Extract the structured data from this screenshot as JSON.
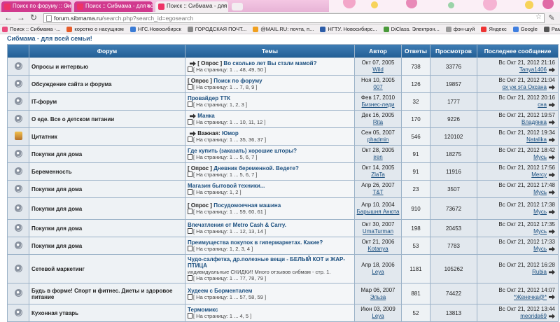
{
  "browser": {
    "tabs": [
      {
        "label": "Поиск по форуму :: Сиб"
      },
      {
        "label": "Поиск :: Сибмама - для вс"
      },
      {
        "label": "Поиск :: Сибмама - для в"
      }
    ],
    "url_host": "forum.sibmama.ru",
    "url_path": "/search.php?search_id=egosearch",
    "bookmarks": [
      {
        "label": "Поиск :: Сибмама -...",
        "color": "#e94b7d"
      },
      {
        "label": "коротко о насущном",
        "color": "#e65c2a"
      },
      {
        "label": "НГС.Новосибирск",
        "color": "#3a7bd5"
      },
      {
        "label": "ГОРОДСКАЯ ПОЧТ...",
        "color": "#888888"
      },
      {
        "label": "@MAIL.RU: почта, п...",
        "color": "#f0a020"
      },
      {
        "label": "НГТУ. Новосибирс...",
        "color": "#2d5da8"
      },
      {
        "label": "DiClass. Электрон...",
        "color": "#4a9a3a"
      },
      {
        "label": "фэн-шуй",
        "color": "#9a9a9a"
      },
      {
        "label": "Яндекс",
        "color": "#e33"
      },
      {
        "label": "Google",
        "color": "#3f7fe0"
      },
      {
        "label": "Рамблер",
        "color": "#555"
      }
    ]
  },
  "site_title": "Сибмама - для всей семьи!",
  "table": {
    "headers": {
      "forum": "Форум",
      "topics": "Темы",
      "author": "Автор",
      "replies": "Ответы",
      "views": "Просмотров",
      "last": "Последнее сообщение"
    },
    "rows": [
      {
        "forum": "Опросы и интервью",
        "prefix": "[ Опрос ]",
        "title": "Во сколько лет Вы стали мамой?",
        "pages": "[ На страницу: 1 ... 48, 49, 50 ]",
        "date": "Окт 07, 2005",
        "author": "Wild",
        "replies": "738",
        "views": "33776",
        "last_date": "Вс Окт 21, 2012 21:16",
        "last_user": "Tanya1406"
      },
      {
        "forum": "Обсуждение сайта и форума",
        "prefix": "[ Опрос ]",
        "title": "Поиск по форуму",
        "pages": "[ На страницу: 1 ... 7, 8, 9 ]",
        "date": "Ноя 10, 2005",
        "author": "007",
        "replies": "126",
        "views": "19857",
        "last_date": "Вс Окт 21, 2012 21:04",
        "last_user": "ох уж эта Оксана"
      },
      {
        "forum": "IT-форум",
        "prefix": "",
        "title": "Провайдер ТТК",
        "pages": "[ На страницу: 1, 2, 3 ]",
        "date": "Фев 17, 2010",
        "author": "Бизнес-леди",
        "replies": "32",
        "views": "1777",
        "last_date": "Вс Окт 21, 2012 20:16",
        "last_user": "сна"
      },
      {
        "forum": "О еде. Все о детском питании",
        "prefix": "",
        "title": "Манка",
        "pages": "[ На страницу: 1 ... 10, 11, 12 ]",
        "date": "Дек 16, 2005",
        "author": "Rita",
        "replies": "170",
        "views": "9226",
        "last_date": "Вс Окт 21, 2012 19:57",
        "last_user": "Владянка"
      },
      {
        "forum": "Цитатник",
        "prefix": "Важная:",
        "title": "Юмор",
        "pages": "[ На страницу: 1 ... 35, 36, 37 ]",
        "date": "Сен 05, 2007",
        "author": "phadmin",
        "replies": "546",
        "views": "120102",
        "last_date": "Вс Окт 21, 2012 19:34",
        "last_user": "Natalika"
      },
      {
        "forum": "Покупки для дома",
        "prefix": "",
        "title": "Где купить (заказать) хорошие шторы?",
        "pages": "[ На страницу: 1 ... 5, 6, 7 ]",
        "date": "Окт 28, 2005",
        "author": "iren",
        "replies": "91",
        "views": "18275",
        "last_date": "Вс Окт 21, 2012 18:42",
        "last_user": "Мусь"
      },
      {
        "forum": "Беременность",
        "prefix": "[ Опрос ]",
        "title": "Дневник беременной. Ведете?",
        "pages": "[ На страницу: 1 ... 5, 6, 7 ]",
        "date": "Окт 14, 2005",
        "author": "ZlaTa",
        "replies": "91",
        "views": "11916",
        "last_date": "Вс Окт 21, 2012 17:56",
        "last_user": "Mercy"
      },
      {
        "forum": "Покупки для дома",
        "prefix": "",
        "title": "Магазин бытовой техники...",
        "pages": "[ На страницу: 1, 2 ]",
        "date": "Апр 26, 2007",
        "author": "T&T",
        "replies": "23",
        "views": "3507",
        "last_date": "Вс Окт 21, 2012 17:48",
        "last_user": "Мусь"
      },
      {
        "forum": "Покупки для дома",
        "prefix": "[ Опрос ]",
        "title": "Посудомоечная машина",
        "pages": "[ На страницу: 1 ... 59, 60, 61 ]",
        "date": "Апр 10, 2004",
        "author": "Барышня Анюта",
        "replies": "910",
        "views": "73672",
        "last_date": "Вс Окт 21, 2012 17:38",
        "last_user": "Мусь"
      },
      {
        "forum": "Покупки для дома",
        "prefix": "",
        "title": "Впечатления от Metro Cash & Carry.",
        "pages": "[ На страницу: 1 ... 12, 13, 14 ]",
        "date": "Окт 30, 2007",
        "author": "UmaTurman",
        "replies": "198",
        "views": "20453",
        "last_date": "Вс Окт 21, 2012 17:35",
        "last_user": "Мусь"
      },
      {
        "forum": "Покупки для дома",
        "prefix": "",
        "title": "Преимущества покупок в гипермаркетах. Какие?",
        "pages": "[ На страницу: 1, 2, 3, 4 ]",
        "date": "Окт 21, 2006",
        "author": "Kotanya",
        "replies": "53",
        "views": "7783",
        "last_date": "Вс Окт 21, 2012 17:33",
        "last_user": "Мусь"
      },
      {
        "forum": "Сетевой маркетинг",
        "prefix": "",
        "title": "Чудо-салфетка, др.полезные вещи - БЕЛЫЙ КОТ и ЖАР-ПТИЦА",
        "subtitle": "индивидуальные СКИДКИ! Много отзывов сибмам - стр. 1.",
        "pages": "[ На страницу: 1 ... 77, 78, 79 ]",
        "date": "Апр 18, 2006",
        "author": "Leya",
        "replies": "1181",
        "views": "105262",
        "last_date": "Вс Окт 21, 2012 16:28",
        "last_user": "Rubia"
      },
      {
        "forum": "Будь в форме! Спорт и фитнес. Диеты и здоровое питание",
        "prefix": "",
        "title": "Худеем с Борменталем",
        "pages": "[ На страницу: 1 ... 57, 58, 59 ]",
        "date": "Мар 06, 2007",
        "author": "Эльза",
        "replies": "881",
        "views": "74422",
        "last_date": "Вс Окт 21, 2012 14:07",
        "last_user": "*Женечка@*"
      },
      {
        "forum": "Кухонная утварь",
        "prefix": "",
        "title": "Термомикс",
        "pages": "[ На страницу: 1 ... 4, 5 ]",
        "date": "Июн 03, 2009",
        "author": "Leya",
        "replies": "52",
        "views": "13813",
        "last_date": "Вс Окт 21, 2012 13:44",
        "last_user": "meorida69"
      }
    ]
  }
}
